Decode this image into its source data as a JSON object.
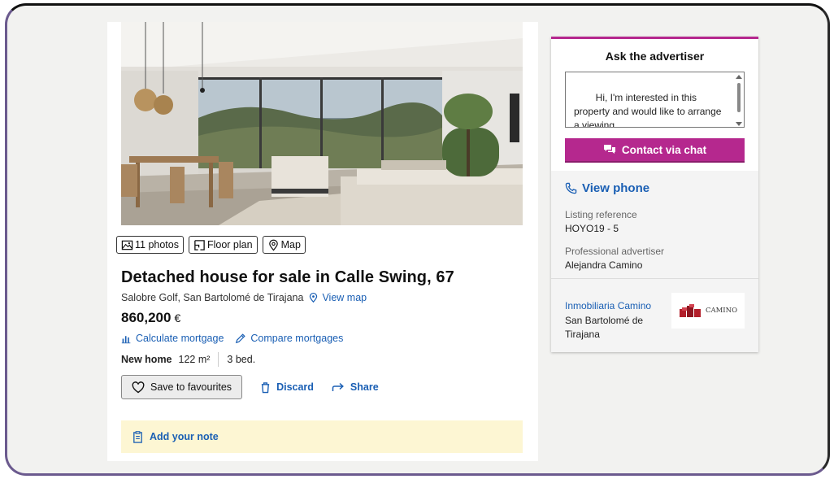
{
  "media_tabs": [
    {
      "label": "11 photos",
      "icon": "image-icon"
    },
    {
      "label": "Floor plan",
      "icon": "floor-plan-icon"
    },
    {
      "label": "Map",
      "icon": "map-pin-icon"
    }
  ],
  "listing": {
    "title": "Detached house for sale in Calle Swing, 67",
    "location": "Salobre Golf, San Bartolomé de Tirajana",
    "view_map": "View map",
    "price": "860,200",
    "currency": "€",
    "calc_mortgage": "Calculate mortgage",
    "compare_mortgages": "Compare mortgages",
    "status": "New home",
    "area": "122 m²",
    "bedrooms": "3 bed."
  },
  "actions": {
    "save": "Save to favourites",
    "discard": "Discard",
    "share": "Share",
    "note": "Add your note"
  },
  "contact": {
    "title": "Ask the advertiser",
    "message": "Hi, I'm interested in this property and would like to arrange a viewing.\nRegards",
    "chat_button": "Contact via chat",
    "view_phone": "View phone",
    "ref_label": "Listing reference",
    "ref_value": "HOYO19 - 5",
    "advertiser_label": "Professional advertiser",
    "advertiser_value": "Alejandra Camino",
    "agency_name": "Inmobiliaria Camino",
    "agency_location": "San Bartolomé de Tirajana",
    "agency_logo_text": "CAMINO"
  },
  "colors": {
    "accent": "#b5288e",
    "link": "#1a5fb4",
    "note_bg": "#fdf6d3"
  }
}
